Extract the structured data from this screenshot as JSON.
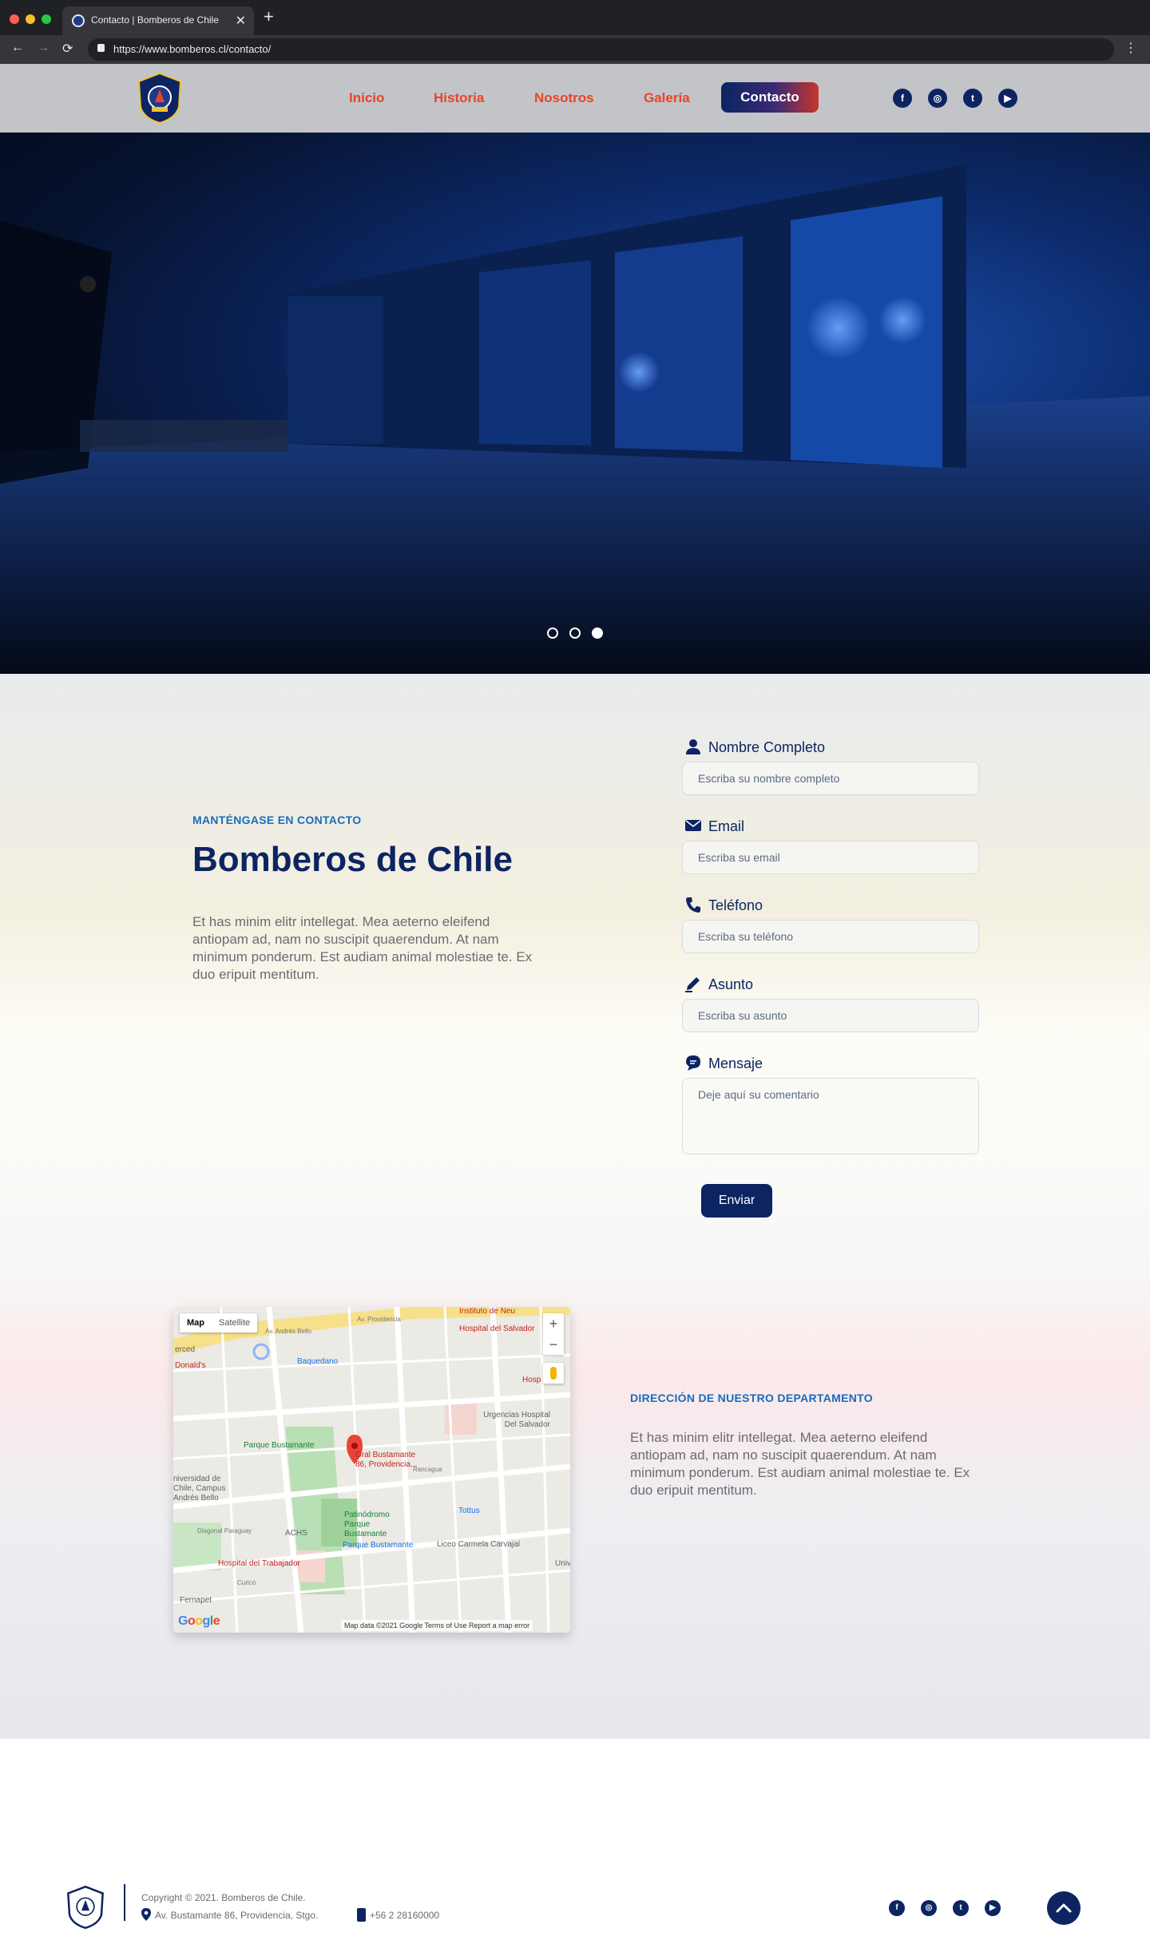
{
  "browser": {
    "tab_title": "Contacto | Bomberos de Chile",
    "tab_close": "✕",
    "new_tab": "+",
    "url": "https://www.bomberos.cl/contacto/",
    "back": "←",
    "forward": "→",
    "reload": "⟳",
    "menu": "⋮"
  },
  "header": {
    "logo_alt": "Bomberos Chile",
    "nav": [
      "Inicio",
      "Historia",
      "Nosotros",
      "Galería",
      "Contacto"
    ],
    "active_nav": "Contacto",
    "social_icons": [
      "facebook-icon",
      "instagram-icon",
      "twitter-icon",
      "youtube-icon"
    ],
    "social_glyphs": [
      "f",
      "◎",
      "t",
      "▶"
    ]
  },
  "hero": {
    "slides": 3,
    "active_slide": 3
  },
  "contact": {
    "eyebrow": "MANTÉNGASE EN CONTACTO",
    "title": "Bomberos de Chile",
    "body": "Et has minim elitr intellegat. Mea aeterno eleifend antiopam ad, nam no suscipit quaerendum. At nam minimum ponderum. Est audiam animal molestiae te. Ex duo eripuit mentitum.",
    "form": {
      "name_label": "Nombre Completo",
      "name_placeholder": "Escriba su nombre completo",
      "email_label": "Email",
      "email_placeholder": "Escriba su email",
      "phone_label": "Teléfono",
      "phone_placeholder": "Escriba su teléfono",
      "subject_label": "Asunto",
      "subject_placeholder": "Escriba su asunto",
      "message_label": "Mensaje",
      "message_placeholder": "Deje aquí su comentario",
      "submit": "Enviar"
    }
  },
  "location": {
    "eyebrow": "DIRECCIÓN DE NUESTRO DEPARTAMENTO",
    "body": "Et has minim elitr intellegat. Mea aeterno eleifend antiopam ad, nam no suscipit quaerendum. At nam minimum ponderum. Est audiam animal molestiae te. Ex duo eripuit mentitum."
  },
  "map": {
    "type_map": "Map",
    "type_satellite": "Satellite",
    "zoom_in": "+",
    "zoom_out": "−",
    "marker_label": "Gral Bustamante 86, Providencia...",
    "places": {
      "hospital_salvador": "Hospital del Salvador",
      "instituto": "Instituto de Neu",
      "baquedano": "Baquedano",
      "donalds": "Donald's",
      "erced": "erced",
      "urgencias": "Urgencias Hospital Del Salvador",
      "parque_bustamante": "Parque Bustamante",
      "universidad": "niversidad de Chile, Campus Andrés Bello",
      "patinodromo": "Patinódromo Parque Bustamante",
      "tottus": "Tottus",
      "achs": "ACHS",
      "metro_parque": "Parque Bustamante",
      "liceo": "Liceo Carmela Carvajal",
      "hospital_trabajador": "Hospital del Trabajador",
      "fernapet": "Fernapet",
      "hosp_short": "Hosp",
      "av_providencia": "Av. Providencia",
      "av_andres_bello": "Av. Andrés Bello",
      "rancagua": "Rancagua",
      "diagonal_paraguay": "Diagonal Paraguay",
      "curico": "Curicó",
      "univ_short": "Univ"
    },
    "google": "Google",
    "footer_text": "Map data ©2021 Google   Terms of Use   Report a map error"
  },
  "footer": {
    "copyright": "Copyright © 2021. Bomberos de Chile.",
    "address": "Av. Bustamante 86, Providencia, Stgo.",
    "phone": "+56 2 28160000",
    "social_icons": [
      "facebook-icon",
      "instagram-icon",
      "twitter-icon",
      "youtube-icon"
    ],
    "social_glyphs": [
      "f",
      "◎",
      "t",
      "▶"
    ]
  },
  "colors": {
    "brand_navy": "#0c2461",
    "accent_red": "#e8442a",
    "eyebrow_blue": "#1a6bbd"
  }
}
